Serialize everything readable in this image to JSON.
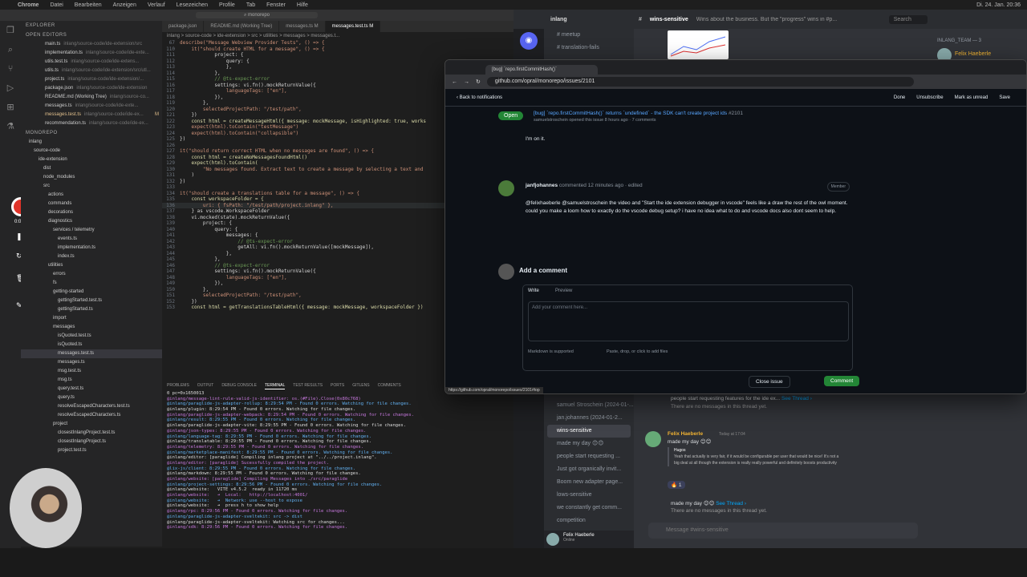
{
  "menubar": {
    "app": "Chrome",
    "items": [
      "Datei",
      "Bearbeiten",
      "Anzeigen",
      "Verlauf",
      "Lesezeichen",
      "Profile",
      "Tab",
      "Fenster",
      "Hilfe"
    ],
    "clock": "Di. 24. Jan. 20:36"
  },
  "vscode": {
    "search_placeholder": "monorepo",
    "explorer_title": "EXPLORER",
    "open_editors_title": "OPEN EDITORS",
    "open_editors": [
      {
        "name": "main.ts",
        "path": "inlang/source-code/ide-extension/src"
      },
      {
        "name": "implementation.ts",
        "path": "inlang/source-code/ide-exte..."
      },
      {
        "name": "utils.test.ts",
        "path": "inlang/source-code/ide-extens..."
      },
      {
        "name": "utils.ts",
        "path": "inlang/source-code/ide-extension/src/utl..."
      },
      {
        "name": "project.ts",
        "path": "inlang/source-code/ide-extension/..."
      },
      {
        "name": "package.json",
        "path": "inlang/source-code/ide-extension"
      },
      {
        "name": "README.md (Working Tree)",
        "path": "inlang/source-co..."
      },
      {
        "name": "messages.ts",
        "path": "inlang/source-code/ide-exte..."
      },
      {
        "name": "messages.test.ts",
        "path": "inlang/source-code/ide-ex...",
        "badge": "M"
      },
      {
        "name": "recommendation.ts",
        "path": "inlang/source-code/ide-ex..."
      }
    ],
    "tree_title": "MONOREPO",
    "tree": [
      "inlang",
      "source-code",
      "ide-extension",
      "dist",
      "node_modules",
      "src",
      "actions",
      "commands",
      "decorations",
      "diagnostics",
      "services / telemetry",
      "events.ts",
      "implementation.ts",
      "index.ts",
      "utilities",
      "errors",
      "fs",
      "getting-started",
      "gettingStarted.test.ts",
      "gettingStarted.ts",
      "import",
      "messages",
      "isQuoted.test.ts",
      "isQuoted.ts",
      "messages.test.ts",
      "messages.ts",
      "msg.test.ts",
      "msg.ts",
      "query.test.ts",
      "query.ts",
      "resolveEscapedCharacters.test.ts",
      "resolveEscapedCharacters.ts",
      "project",
      "closestInlangProject.test.ts",
      "closestInlangProject.ts",
      "project.test.ts"
    ],
    "tabs": [
      "package.json",
      "README.md (Working Tree)",
      "messages.ts M",
      "messages.test.ts M"
    ],
    "breadcrumb": "inlang > source-code > ide-extension > src > utilities > messages > messages.t...",
    "code": [
      {
        "n": "67",
        "t": "describe(\"Message Webview Provider Tests\", () => {"
      },
      {
        "n": "110",
        "t": "    it(\"should create HTML for a message\", () => {"
      },
      {
        "n": "111",
        "t": "            project: {"
      },
      {
        "n": "112",
        "t": "                query: {"
      },
      {
        "n": "113",
        "t": "                },"
      },
      {
        "n": "114",
        "t": "            },"
      },
      {
        "n": "115",
        "t": "            // @ts-expect-error"
      },
      {
        "n": "116",
        "t": "            settings: vi.fn().mockReturnValue({"
      },
      {
        "n": "117",
        "t": "                languageTags: [\"en\"],"
      },
      {
        "n": "118",
        "t": "            }),"
      },
      {
        "n": "119",
        "t": "        },"
      },
      {
        "n": "120",
        "t": "        selectedProjectPath: \"/test/path\","
      },
      {
        "n": "121",
        "t": "    })"
      },
      {
        "n": "122",
        "t": "    const html = createMessageHtml({ message: mockMessage, isHighlighted: true, works"
      },
      {
        "n": "123",
        "t": "    expect(html).toContain(\"testMessage\")"
      },
      {
        "n": "124",
        "t": "    expect(html).toContain(\"collapsible\")"
      },
      {
        "n": "125",
        "t": "})"
      },
      {
        "n": "126",
        "t": ""
      },
      {
        "n": "127",
        "t": "it(\"should return correct HTML when no messages are found\", () => {"
      },
      {
        "n": "128",
        "t": "    const html = createNoMessagesFoundHtml()"
      },
      {
        "n": "129",
        "t": "    expect(html).toContain("
      },
      {
        "n": "130",
        "t": "        \"No messages found. Extract text to create a message by selecting a text and"
      },
      {
        "n": "131",
        "t": "    )"
      },
      {
        "n": "132",
        "t": "})"
      },
      {
        "n": "133",
        "t": ""
      },
      {
        "n": "134",
        "t": "it(\"should create a translations table for a message\", () => {"
      },
      {
        "n": "135",
        "t": "    const workspaceFolder = {"
      },
      {
        "n": "136",
        "t": "        uri: { fsPath: \"/test/path/project.inlang\" },"
      },
      {
        "n": "137",
        "t": "    } as vscode.WorkspaceFolder"
      },
      {
        "n": "138",
        "t": "    vi.mocked(state).mockReturnValue({"
      },
      {
        "n": "139",
        "t": "        project: {"
      },
      {
        "n": "140",
        "t": "            query: {"
      },
      {
        "n": "141",
        "t": "                messages: {"
      },
      {
        "n": "142",
        "t": "                    // @ts-expect-error"
      },
      {
        "n": "143",
        "t": "                    getAll: vi.fn().mockReturnValue([mockMessage]),"
      },
      {
        "n": "144",
        "t": "                },"
      },
      {
        "n": "145",
        "t": "            },"
      },
      {
        "n": "146",
        "t": "            // @ts-expect-error"
      },
      {
        "n": "147",
        "t": "            settings: vi.fn().mockReturnValue({"
      },
      {
        "n": "148",
        "t": "                languageTags: [\"en\"],"
      },
      {
        "n": "149",
        "t": "            }),"
      },
      {
        "n": "150",
        "t": "        },"
      },
      {
        "n": "151",
        "t": "        selectedProjectPath: \"/test/path\","
      },
      {
        "n": "152",
        "t": "    })"
      },
      {
        "n": "153",
        "t": "    const html = getTranslationsTableHtml({ message: mockMessage, workspaceFolder })"
      }
    ],
    "panel_tabs": [
      "PROBLEMS",
      "OUTPUT",
      "DEBUG CONSOLE",
      "TERMINAL",
      "TEST RESULTS",
      "PORTS",
      "GITLENS",
      "COMMENTS"
    ],
    "terminal": [
      "0 pc=0x1650013",
      "@inlang/message-lint-rule-valid-js-identifier: os.(#File).Close(0x80c768)",
      "@inlang/paraglide-js-adapter-rollup: 8:29:54 PM - Found 0 errors. Watching for file changes.",
      "@inlang/plugin: 8:29:54 PM - Found 0 errors. Watching for file changes.",
      "@inlang/paraglide-js-adapter-webpack: 8:29:54 PM - Found 0 errors. Watching for file changes.",
      "@inlang/result: 8:29:55 PM - Found 0 errors. Watching for file changes.",
      "@inlang/paraglide-js-adapter-vite: 8:29:55 PM - Found 0 errors. Watching for file changes.",
      "@inlang/json-types: 8:29:55 PM - Found 0 errors. Watching for file changes.",
      "@inlang/language-tag: 8:29:55 PM - Found 0 errors. Watching for file changes.",
      "@inlang/translatable: 8:29:55 PM - Found 0 errors. Watching for file changes.",
      "@inlang/telemetry: 8:29:55 PM - Found 0 errors. Watching for file changes.",
      "@inlang/marketplace-manifest: 8:29:55 PM - Found 0 errors. Watching for file changes.",
      "@inlang/editor: [paraglide] Compiling inlang project at \"../../project.inlang\".",
      "@inlang/editor: [paraglide] Sucessfully compiled the project.",
      "@lix-js/client: 8:29:55 PM - Found 0 errors. Watching for file changes.",
      "@inlang/markdown: 8:29:55 PM - Found 0 errors. Watching for file changes.",
      "@inlang/website: [paraglide] Compiling Messages into ./src/paraglide",
      "@inlang/project-settings: 8:29:56 PM - Found 0 errors. Watching for file changes.",
      "@inlang/website:   VITE v4.5.2  ready in 11720 ms",
      "@inlang/website:   ➜  Local:   http://localhost:4001/",
      "@inlang/website:   ➜  Network: use --host to expose",
      "@inlang/website:   ➜  press h to show help",
      "@inlang/rpc: 8:29:56 PM - Found 0 errors. Watching for file changes.",
      "@inlang/paraglide-js-adapter-sveltekit: src -> dist",
      "@inlang/paraglide-js-adapter-sveltekit: Watching src for changes...",
      "@inlang/sdk: 8:29:56 PM - Found 0 errors. Watching for file changes."
    ],
    "statusbar": [
      "add-recommendation-banner-to-inlang-tab*",
      "0 ⚠ 0",
      "debug vs-code-extension (monorepo)",
      "Vitest",
      "Live Share",
      "Git Graph",
      "UTF-8",
      "LF",
      "TypeScript",
      "Prettier"
    ],
    "timer": "0:00"
  },
  "discord": {
    "server": "inlang",
    "channel": "wins-sensitive",
    "topic": "Wins about the business. But the \"progress\" wins in #p...",
    "search_placeholder": "Search",
    "channels_top": [
      "meetup",
      "translation-fails"
    ],
    "channels": [
      "samuel Stroschein (2024-01-...",
      "jan.johannes (2024-01-2...",
      "wins-sensitive",
      "made my day 😊😊",
      "people start requesting ...",
      "Just got organically invit...",
      "Boom new adapter page...",
      "lows-sensitive",
      "we constantly get comm...",
      "competition"
    ],
    "member_section": "INLANG_TEAM — 3",
    "member": "Felix Haeberle",
    "thread_banner": "people start requesting features for the ide ex...",
    "see_thread": "See Thread ›",
    "no_recent": "There are no messages in this thread yet.",
    "msg_author": "Felix Haeberle",
    "msg_time": "Today at 17:04",
    "msg_text": "made my day 😊😊",
    "quote_author": "Hugos",
    "quote_text": "Yeah that actually is very fair, if it would be configurable per user that would be nice! It's not a big deal at all though the extension is really really powerful and definitely boosts productivity",
    "reaction": "🔥 1",
    "thread2": "made my day 😊😊",
    "input_placeholder": "Message #wins-sensitive",
    "user": "Felix Haeberle",
    "user_status": "Online"
  },
  "browser": {
    "tab_title": "[bug] `repo.firstCommitHash()`",
    "url": "github.com/opral/monorepo/issues/2101",
    "back": "‹ Back to notifications",
    "actions": [
      "Done",
      "Unsubscribe",
      "Mark as unread",
      "Save"
    ],
    "state": "Open",
    "issue_title": "[bug] `repo.firstCommitHash()` returns `undefined` - the SDK can't create project ids",
    "issue_number": "#2101",
    "issue_meta": "samuelstroschein opened this issue 8 hours ago · 7 comments",
    "prev_comment": "I'm on it.",
    "comment_author": "janfjohannes",
    "comment_meta": "commented 12 minutes ago · edited",
    "comment_role": "Member",
    "comment_body": "@felixhaeberle @samuelstroschein the video and \"Start the ide extension debugger in vscode\" feels like a draw the rest of the owl moment. could you make a loom how to exactly do the vscode debug setup? i have no idea what to do and vscode docs also dont seem to help.",
    "add_comment": "Add a comment",
    "tab_write": "Write",
    "tab_preview": "Preview",
    "comment_placeholder": "Add your comment here...",
    "markdown_note": "Markdown is supported",
    "attach_note": "Paste, drop, or click to add files",
    "close_issue": "Close issue",
    "comment_btn": "Comment",
    "link_preview": "https://github.com/opral/monorepo/issues/2101#top"
  }
}
